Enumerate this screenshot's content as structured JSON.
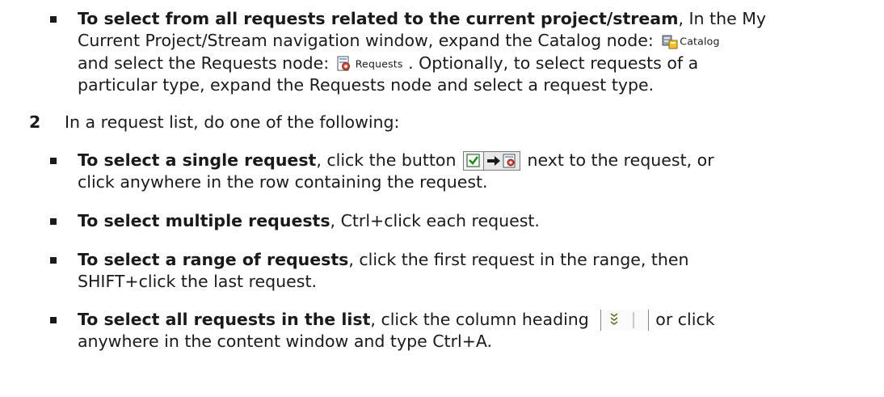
{
  "items": {
    "project_bullet": {
      "heading": "To select from all requests related to the current project/stream",
      "text_1": ", In the My",
      "text_2": "Current Project/Stream navigation window, expand the Catalog node: ",
      "catalog_label": "Catalog",
      "text_3": "and select the Requests node: ",
      "requests_label": "Requests",
      "text_4": " . Optionally, to select requests of a",
      "text_5": "particular type, expand the Requests node and select a request type."
    },
    "step2": {
      "number": "2",
      "text": "In a request list, do one of the following:"
    },
    "single": {
      "heading": "To select a single request",
      "text_1": ", click the button ",
      "text_2": "  next to the request, or",
      "text_3": "click anywhere in the row containing the request."
    },
    "multiple": {
      "heading": "To select multiple requests",
      "text_1": ", Ctrl+click each request."
    },
    "range": {
      "heading": "To select a range of requests",
      "text_1": ", click the first request in the range, then",
      "text_2": "SHIFT+click the last request."
    },
    "all": {
      "heading": "To select all requests in the list",
      "text_1": ", click the column heading ",
      "text_2": "or click",
      "text_3": "anywhere in the content window and type Ctrl+A."
    }
  },
  "icons": {
    "catalog": "catalog-icon",
    "requests": "requests-icon",
    "checkbox": "checkbox-icon",
    "open_request": "arrow-request-icon",
    "column_heading": "select-all-heading-icon"
  }
}
